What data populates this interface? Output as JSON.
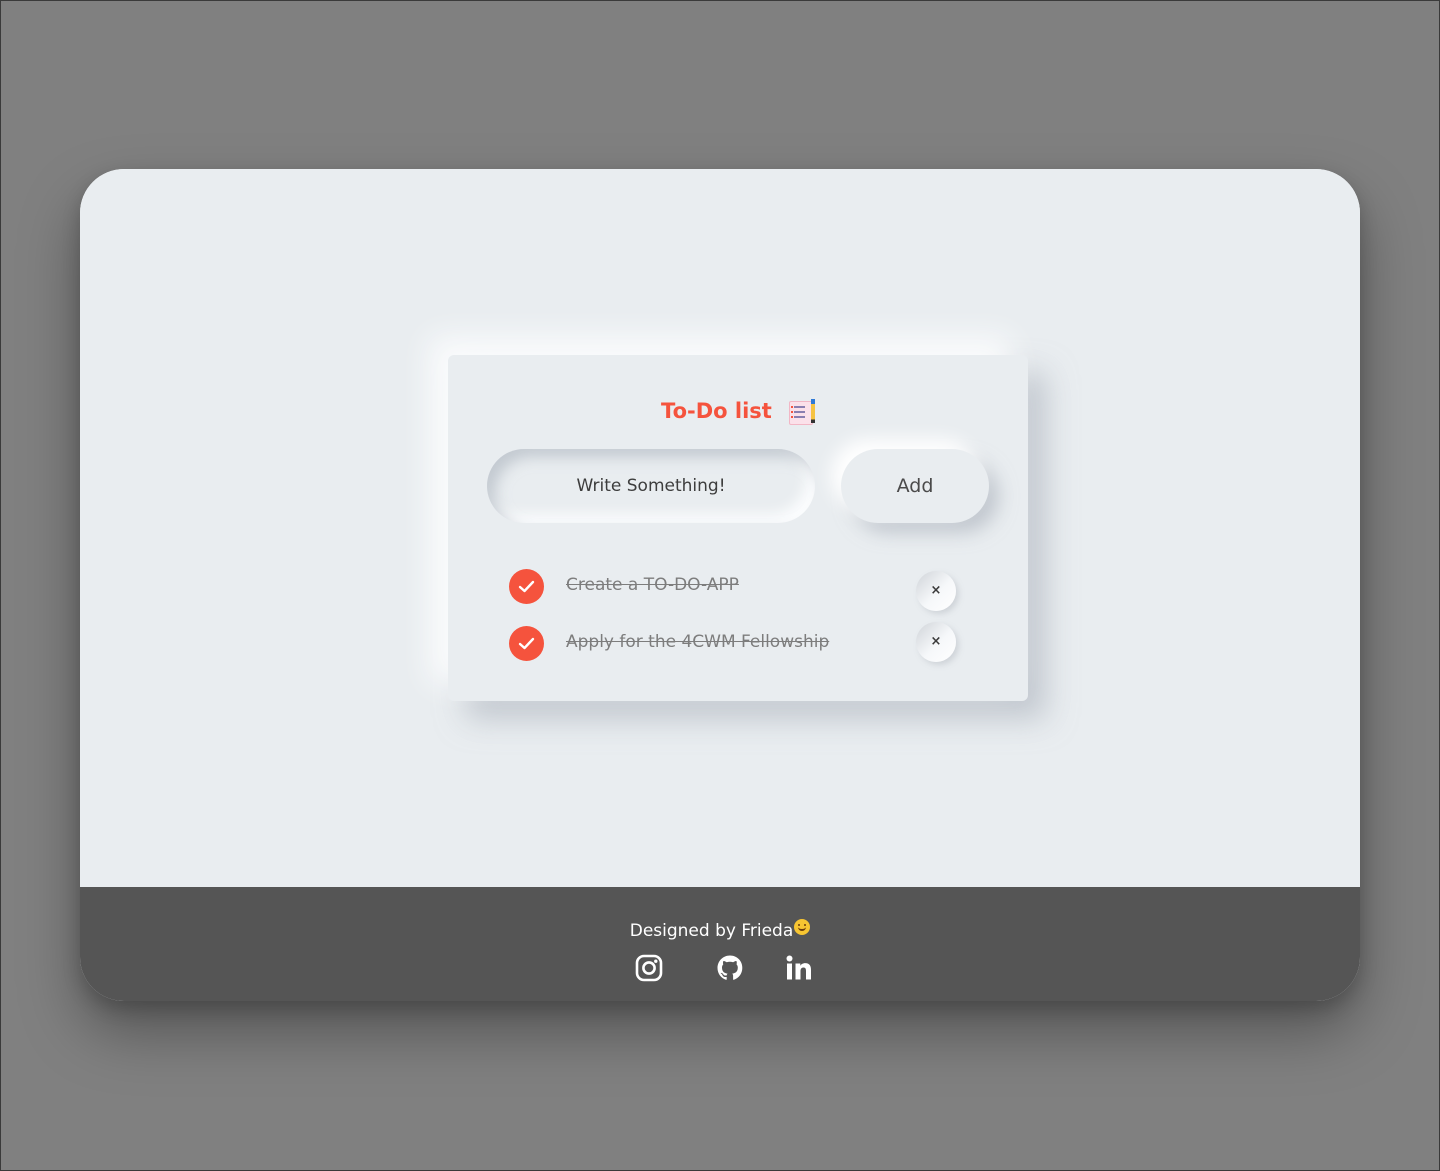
{
  "app": {
    "title": "To-Do list",
    "title_emoji_icon": "memo-pad-icon",
    "accent_color": "#f5533d"
  },
  "input": {
    "placeholder": "Write Something!",
    "value": ""
  },
  "add_button": {
    "label": "Add"
  },
  "tasks": [
    {
      "text": "Create a TO-DO-APP",
      "completed": true,
      "delete_label": "×"
    },
    {
      "text": "Apply for the 4CWM Fellowship",
      "completed": true,
      "delete_label": "×"
    }
  ],
  "footer": {
    "credit_text": "Designed by Frieda",
    "credit_emoji_icon": "smiling-face-icon",
    "socials": [
      {
        "name": "instagram",
        "icon": "instagram-icon"
      },
      {
        "name": "github",
        "icon": "github-icon"
      },
      {
        "name": "linkedin",
        "icon": "linkedin-icon"
      }
    ]
  }
}
